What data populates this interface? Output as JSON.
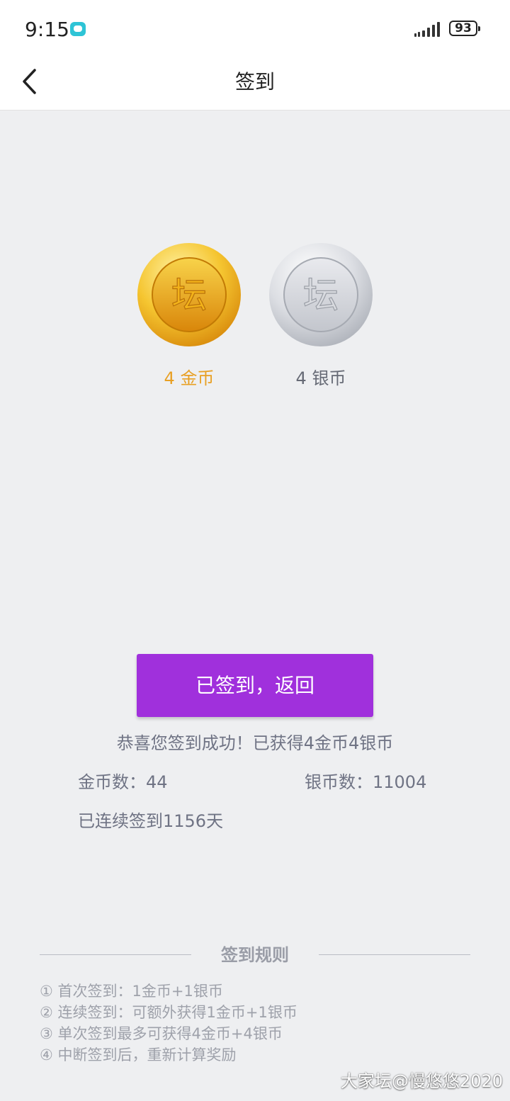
{
  "status_bar": {
    "time": "9:15",
    "battery": "93"
  },
  "nav": {
    "title": "签到"
  },
  "rewards": {
    "gold_label": "4 金币",
    "silver_label": "4 银币",
    "coin_char": "坛"
  },
  "actions": {
    "signed_back_label": "已签到，返回"
  },
  "result": {
    "success_message": "恭喜您签到成功！已获得4金币4银币",
    "gold_count": "金币数：44",
    "silver_count": "银币数：11004",
    "streak": "已连续签到1156天"
  },
  "rules": {
    "title": "签到规则",
    "items": [
      "① 首次签到：1金币+1银币",
      "② 连续签到：可额外获得1金币+1银币",
      "③ 单次签到最多可获得4金币+4银币",
      "④ 中断签到后，重新计算奖励"
    ]
  },
  "watermark": "大家坛@慢悠悠2020",
  "colors": {
    "accent": "#a030dc",
    "gold": "#e8a024",
    "background": "#eeeff1"
  }
}
